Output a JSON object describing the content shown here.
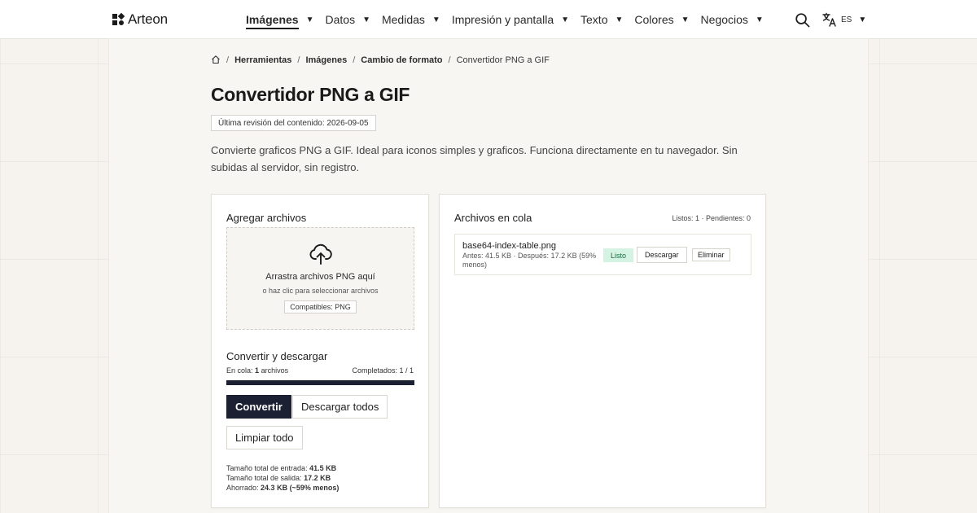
{
  "header": {
    "brand": "Arteon",
    "nav": [
      {
        "label": "Imágenes",
        "active": true
      },
      {
        "label": "Datos"
      },
      {
        "label": "Medidas"
      },
      {
        "label": "Impresión y pantalla"
      },
      {
        "label": "Texto"
      },
      {
        "label": "Colores"
      },
      {
        "label": "Negocios"
      }
    ],
    "lang_code": "ES"
  },
  "breadcrumb": {
    "items": [
      "Herramientas",
      "Imágenes",
      "Cambio de formato"
    ],
    "current": "Convertidor PNG a GIF"
  },
  "page": {
    "title": "Convertidor PNG a GIF",
    "revision": "Última revisión del contenido: 2026-09-05",
    "intro": "Convierte graficos PNG a GIF. Ideal para iconos simples y graficos. Funciona directamente en tu navegador. Sin subidas al servidor, sin registro."
  },
  "add_files": {
    "title": "Agregar archivos",
    "drop_main": "Arrastra archivos PNG aquí",
    "drop_sub": "o haz clic para seleccionar archivos",
    "compat": "Compatibles: PNG"
  },
  "convert": {
    "title": "Convertir y descargar",
    "queue_prefix": "En cola:",
    "queue_count": "1",
    "queue_suffix": "archivos",
    "completed": "Completados: 1 / 1",
    "progress": 1.0,
    "convert_label": "Convertir",
    "download_all_label": "Descargar todos",
    "clear_label": "Limpiar todo",
    "input_label": "Tamaño total de entrada:",
    "input_value": "41.5 KB",
    "output_label": "Tamaño total de salida:",
    "output_value": "17.2 KB",
    "saved_label": "Ahorrado:",
    "saved_value": "24.3 KB (~59% menos)"
  },
  "queue": {
    "title": "Archivos en cola",
    "counts": "Listos: 1 · Pendientes: 0",
    "files": [
      {
        "name": "base64-index-table.png",
        "meta": "Antes: 41.5 KB · Después: 17.2 KB (59% menos)",
        "status": "Listo",
        "download_label": "Descargar",
        "delete_label": "Eliminar"
      }
    ]
  },
  "colors": {
    "accent_dark": "#1b2133",
    "status_ready_bg": "#d4f3e3",
    "status_ready_text": "#1d6b43"
  },
  "icons": [
    "brand-logo-icon",
    "caret-down-icon",
    "search-icon",
    "translate-icon",
    "home-icon",
    "upload-cloud-icon"
  ]
}
